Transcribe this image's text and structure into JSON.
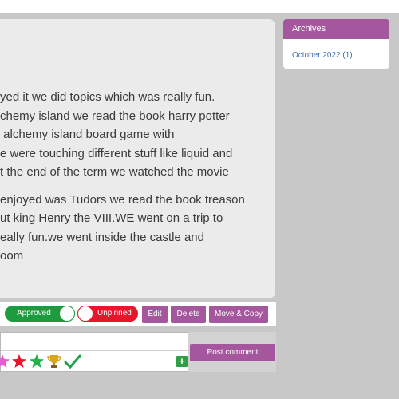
{
  "post": {
    "body_lines_p1": [
      "yed it we did topics which was really fun.",
      "chemy island we read the book harry potter",
      " alchemy island board game with",
      "e were touching different stuff like liquid and",
      "t the end of the term we watched the movie"
    ],
    "body_lines_p2": [
      "enjoyed was Tudors we read the book treason",
      "ut king Henry the VIII.WE went on a trip to",
      "eally fun.we went inside the castle and",
      "oom"
    ]
  },
  "actions": {
    "approved_label": "Approved",
    "unpinned_label": "Unpinned",
    "edit_label": "Edit",
    "delete_label": "Delete",
    "move_copy_label": "Move & Copy"
  },
  "comment": {
    "post_label": "Post comment",
    "emoji_icons": [
      "star-pink-icon",
      "star-red-icon",
      "star-green-icon",
      "trophy-icon",
      "checkmark-icon"
    ],
    "add_label": "+"
  },
  "archives": {
    "title": "Archives",
    "links": [
      "October 2022 (1)"
    ]
  },
  "colors": {
    "accent": "#a5579e",
    "approved": "#1c9b3f",
    "unpinned": "#e8152b",
    "link": "#3b6fb5"
  }
}
